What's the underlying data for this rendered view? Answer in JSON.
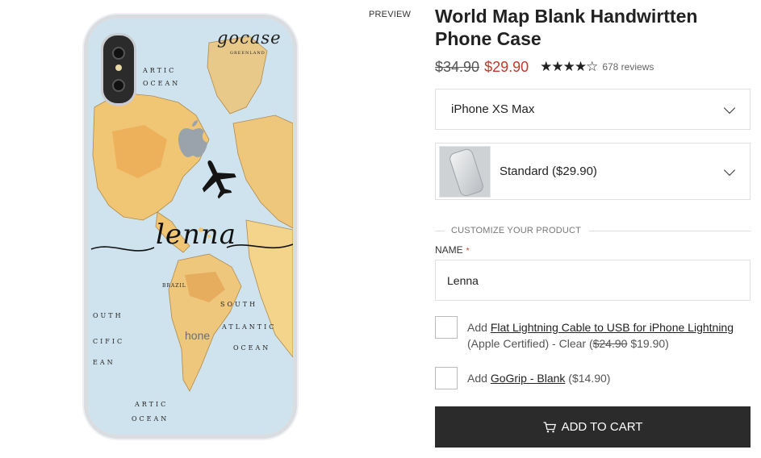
{
  "preview": {
    "label": "PREVIEW"
  },
  "phone_art": {
    "brand": "gocase",
    "signature": "lenna",
    "phone_text": "hone",
    "labels": [
      "ARTIC",
      "OCEAN",
      "SOUTH",
      "ATLANTIC",
      "OCEAN",
      "OUTH",
      "CIFIC",
      "EAN",
      "ARTIC",
      "OCEAN",
      "GREENLAND",
      "BRAZIL"
    ]
  },
  "product": {
    "title": "World Map Blank Handwirtten Phone Case",
    "price_old": "$34.90",
    "price_new": "$29.90",
    "rating": 4.5,
    "stars": "★★★★☆",
    "reviews": "678 reviews"
  },
  "model_select": {
    "value": "iPhone XS Max"
  },
  "style_select": {
    "value": "Standard ($29.90)"
  },
  "customize": {
    "heading": "CUSTOMIZE YOUR PRODUCT",
    "name_label": "NAME",
    "required_mark": "*",
    "name_value": "Lenna"
  },
  "addons": [
    {
      "prefix": "Add",
      "link": "Flat Lightning Cable to USB for iPhone Lightning",
      "detail_start": "(Apple Certified) - Clear (",
      "old_price": "$24.90",
      "new_price": " $19.90)"
    },
    {
      "prefix": "Add",
      "link": "GoGrip - Blank",
      "price": " ($14.90)"
    }
  ],
  "cart": {
    "label": "ADD TO CART"
  },
  "colors": {
    "accent_price": "#c0392b",
    "button_bg": "#2b2b2b",
    "border": "#e0e0e0"
  }
}
